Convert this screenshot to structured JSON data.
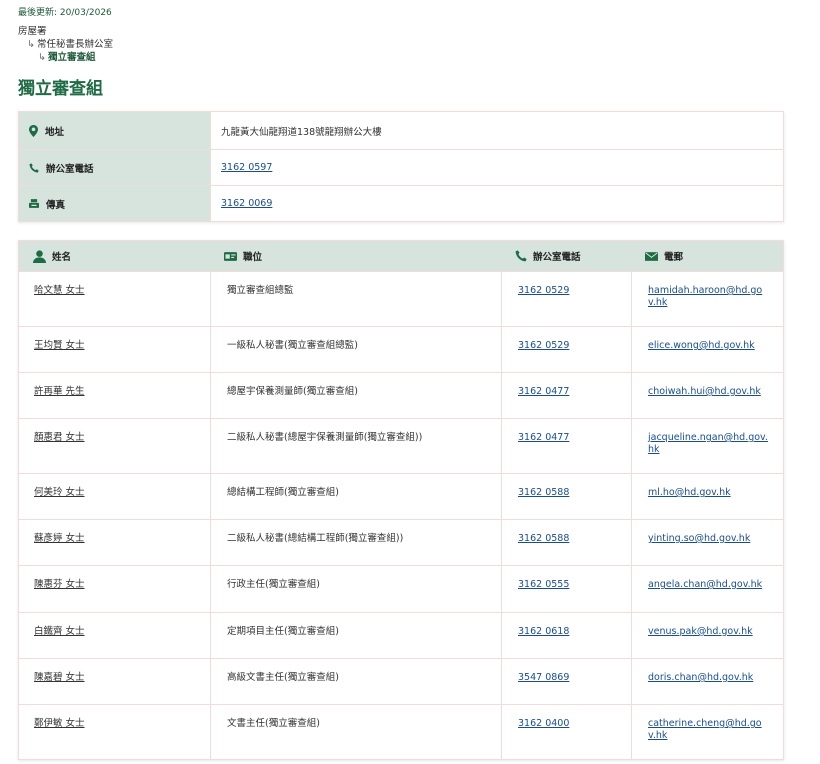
{
  "last_updated": "最後更新: 20/03/2026",
  "breadcrumb": [
    "房屋署",
    "常任秘書長辦公室",
    "獨立審查組"
  ],
  "page_title": "獨立審查組",
  "info": {
    "address_label": "地址",
    "address_value": "九龍黃大仙龍翔道138號龍翔辦公大樓",
    "phone_label": "辦公室電話",
    "phone_value": "3162 0597",
    "fax_label": "傳真",
    "fax_value": "3162 0069"
  },
  "table": {
    "headers": {
      "name": "姓名",
      "post": "職位",
      "phone": "辦公室電話",
      "email": "電郵"
    },
    "rows": [
      {
        "name": "哈文慧 女士",
        "post": "獨立審查組總監",
        "phone": "3162 0529",
        "email": "hamidah.haroon@hd.gov.hk"
      },
      {
        "name": "王均賢 女士",
        "post": "一級私人秘書(獨立審查組總監)",
        "phone": "3162 0529",
        "email": "elice.wong@hd.gov.hk"
      },
      {
        "name": "許再華 先生",
        "post": "總屋宇保養測量師(獨立審查組)",
        "phone": "3162 0477",
        "email": "choiwah.hui@hd.gov.hk"
      },
      {
        "name": "顏惠君 女士",
        "post": "二級私人秘書(總屋宇保養測量師(獨立審查組))",
        "phone": "3162 0477",
        "email": "jacqueline.ngan@hd.gov.hk"
      },
      {
        "name": "何美玲 女士",
        "post": "總結構工程師(獨立審查組)",
        "phone": "3162 0588",
        "email": "ml.ho@hd.gov.hk"
      },
      {
        "name": "蘇彥婷 女士",
        "post": "二級私人秘書(總結構工程師(獨立審查組))",
        "phone": "3162 0588",
        "email": "yinting.so@hd.gov.hk"
      },
      {
        "name": "陳惠芬 女士",
        "post": "行政主任(獨立審查組)",
        "phone": "3162 0555",
        "email": "angela.chan@hd.gov.hk"
      },
      {
        "name": "白鐵齊 女士",
        "post": "定期項目主任(獨立審查組)",
        "phone": "3162 0618",
        "email": "venus.pak@hd.gov.hk"
      },
      {
        "name": "陳嘉碧 女士",
        "post": "高級文書主任(獨立審查組)",
        "phone": "3547 0869",
        "email": "doris.chan@hd.gov.hk"
      },
      {
        "name": "鄭伊敏 女士",
        "post": "文書主任(獨立審查組)",
        "phone": "3162 0400",
        "email": "catherine.cheng@hd.gov.hk"
      }
    ]
  },
  "icons": {
    "address": "map-pin-icon",
    "phone": "phone-icon",
    "fax": "fax-icon",
    "name": "person-icon",
    "post": "id-card-icon",
    "email": "envelope-icon"
  },
  "colors": {
    "accent": "#1e6b44",
    "header_bg": "#d6e4dd",
    "link": "#1a4d8f",
    "border": "#f1dcdc"
  }
}
